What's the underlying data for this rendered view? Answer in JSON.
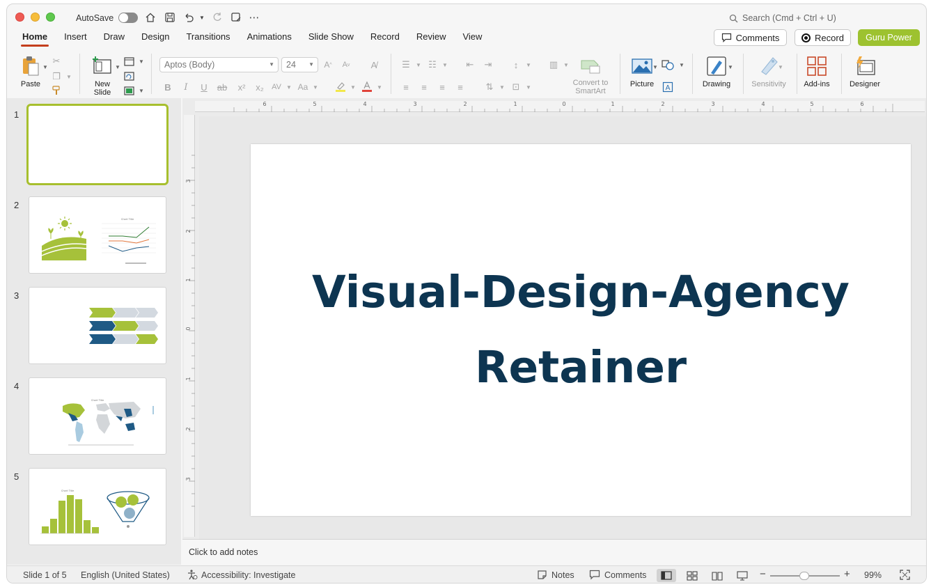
{
  "titlebar": {
    "autosave_label": "AutoSave",
    "search_placeholder": "Search (Cmd + Ctrl + U)"
  },
  "tabs": [
    {
      "label": "Home",
      "active": true
    },
    {
      "label": "Insert"
    },
    {
      "label": "Draw"
    },
    {
      "label": "Design"
    },
    {
      "label": "Transitions"
    },
    {
      "label": "Animations"
    },
    {
      "label": "Slide Show"
    },
    {
      "label": "Record"
    },
    {
      "label": "Review"
    },
    {
      "label": "View"
    }
  ],
  "top_buttons": {
    "comments": "Comments",
    "record": "Record",
    "guru": "Guru Power"
  },
  "ribbon": {
    "paste": "Paste",
    "new_slide_1": "New",
    "new_slide_2": "Slide",
    "font_name": "Aptos (Body)",
    "font_size": "24",
    "convert_1": "Convert to",
    "convert_2": "SmartArt",
    "picture": "Picture",
    "drawing": "Drawing",
    "sensitivity": "Sensitivity",
    "addins": "Add-ins",
    "designer": "Designer"
  },
  "thumbnails": {
    "numbers": [
      "1",
      "2",
      "3",
      "4",
      "5"
    ]
  },
  "slide": {
    "title_line1": "Visual-Design-Agency",
    "title_line2": "Retainer"
  },
  "notes": {
    "placeholder": "Click to add notes"
  },
  "status": {
    "slide_counter": "Slide 1 of 5",
    "language": "English (United States)",
    "accessibility": "Accessibility: Investigate",
    "notes": "Notes",
    "comments": "Comments",
    "zoom": "99%"
  },
  "colors": {
    "accent_tab": "#c43e1c",
    "guru": "#9dc230",
    "title_text": "#0d3551",
    "selected_thumb": "#a7bf2e"
  }
}
